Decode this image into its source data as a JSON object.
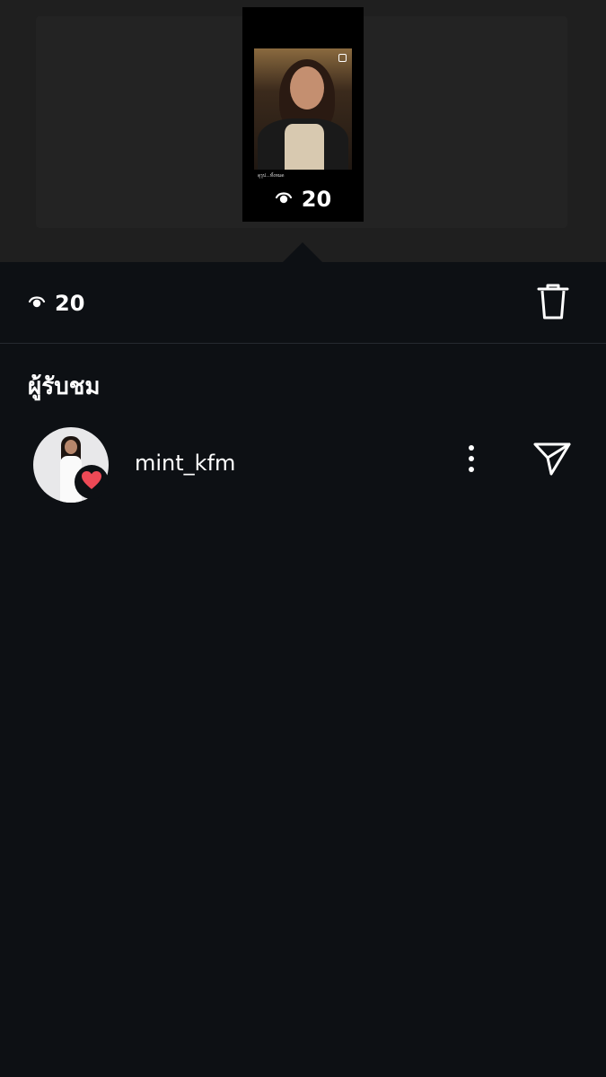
{
  "story": {
    "caption": "ดูรูป...ทั้งหมด",
    "views": "20"
  },
  "header": {
    "views": "20",
    "trash_icon": "trash-icon"
  },
  "viewers_section": {
    "title": "ผู้รับชม"
  },
  "viewers": [
    {
      "username": "mint_kfm",
      "reaction_icon": "heart-icon",
      "more_icon": "more-vertical-icon",
      "send_icon": "send-icon"
    }
  ],
  "colors": {
    "background": "#0d1014",
    "overlay": "#1f1f1f",
    "text": "#ffffff",
    "heart": "#ed4956"
  }
}
